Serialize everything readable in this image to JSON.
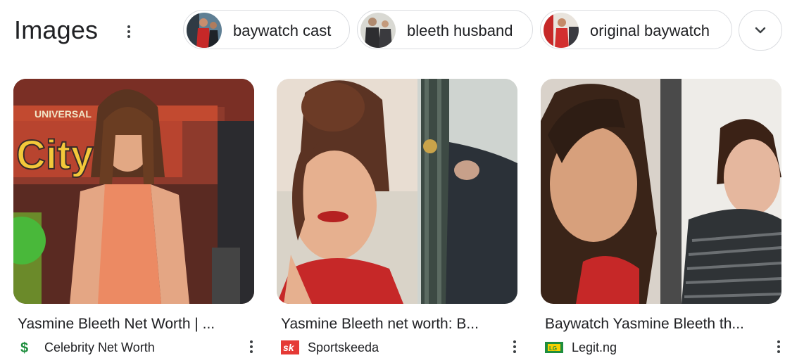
{
  "header": {
    "title": "Images"
  },
  "chips": [
    {
      "label": "baywatch cast",
      "icon": "baywatch-cast-thumbnail"
    },
    {
      "label": "bleeth husband",
      "icon": "bleeth-husband-thumbnail"
    },
    {
      "label": "original baywatch",
      "icon": "original-baywatch-thumbnail"
    }
  ],
  "results": [
    {
      "caption": "Yasmine Bleeth Net Worth | ...",
      "source": "Celebrity Net Worth",
      "favicon": "dollar-sign-icon"
    },
    {
      "caption": "Yasmine Bleeth net worth: B...",
      "source": "Sportskeeda",
      "favicon": "sportskeeda-icon"
    },
    {
      "caption": "Baywatch Yasmine Bleeth th...",
      "source": "Legit.ng",
      "favicon": "legit-icon"
    }
  ],
  "colors": {
    "text": "#202124",
    "chip_border": "#dadce0",
    "celebrity_favicon": "#1e8e3e",
    "sportskeeda_favicon": "#e53935",
    "legit_favicon": "#1e8e3e"
  },
  "icons": {
    "more_options": "three-dot-vertical-icon",
    "expand": "chevron-down-icon"
  }
}
